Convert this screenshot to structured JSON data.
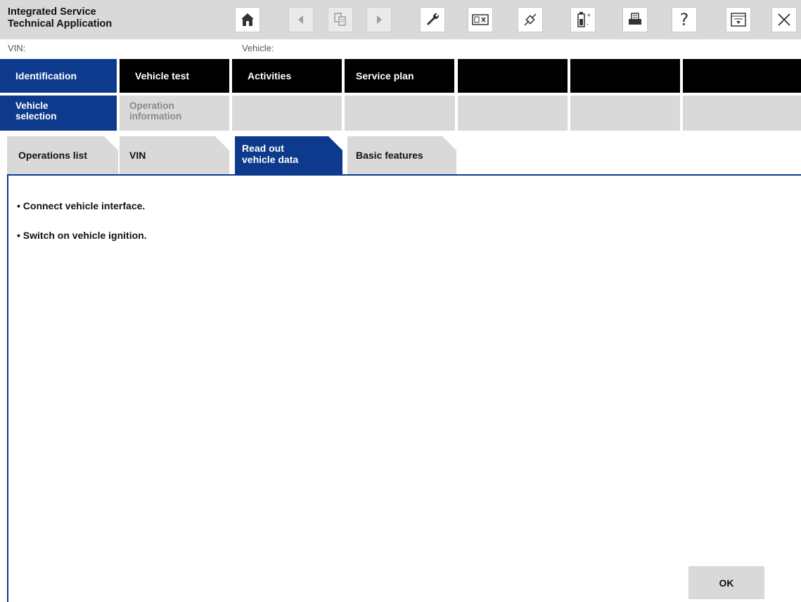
{
  "app": {
    "title": "Integrated Service\nTechnical Application"
  },
  "toolbar": {
    "icons": [
      "home-icon",
      "back-icon",
      "clipboard-icon",
      "forward-icon",
      "wrench-icon",
      "panel-icon",
      "connection-icon",
      "battery-icon",
      "print-icon",
      "help-icon",
      "window-icon",
      "close-icon"
    ],
    "help_glyph": "?"
  },
  "info": {
    "vin_label": "VIN:",
    "vehicle_label": "Vehicle:"
  },
  "main_menu": {
    "tabs": [
      {
        "label": "Identification",
        "active": true
      },
      {
        "label": "Vehicle test",
        "active": false
      },
      {
        "label": "Activities",
        "active": false
      },
      {
        "label": "Service plan",
        "active": false
      },
      {
        "label": "",
        "active": false
      },
      {
        "label": "",
        "active": false
      },
      {
        "label": "",
        "active": false
      }
    ]
  },
  "sub_menu": {
    "tabs": [
      {
        "label": "Vehicle\nselection",
        "active": true
      },
      {
        "label": "Operation\ninformation",
        "active": false
      },
      {
        "label": "",
        "active": false
      },
      {
        "label": "",
        "active": false
      },
      {
        "label": "",
        "active": false
      },
      {
        "label": "",
        "active": false
      },
      {
        "label": "",
        "active": false
      }
    ]
  },
  "page_tabs": {
    "tabs": [
      {
        "label": "Operations list",
        "active": false
      },
      {
        "label": "VIN",
        "active": false
      },
      {
        "label": "Read out\nvehicle data",
        "active": true
      },
      {
        "label": "Basic features",
        "active": false
      }
    ]
  },
  "content": {
    "instructions": [
      "• Connect vehicle interface.",
      "• Switch on vehicle ignition."
    ],
    "ok_label": "OK"
  },
  "colors": {
    "accent": "#0d3a8c",
    "toolbar_bg": "#d9d9d9",
    "menu_bg": "#000000"
  }
}
